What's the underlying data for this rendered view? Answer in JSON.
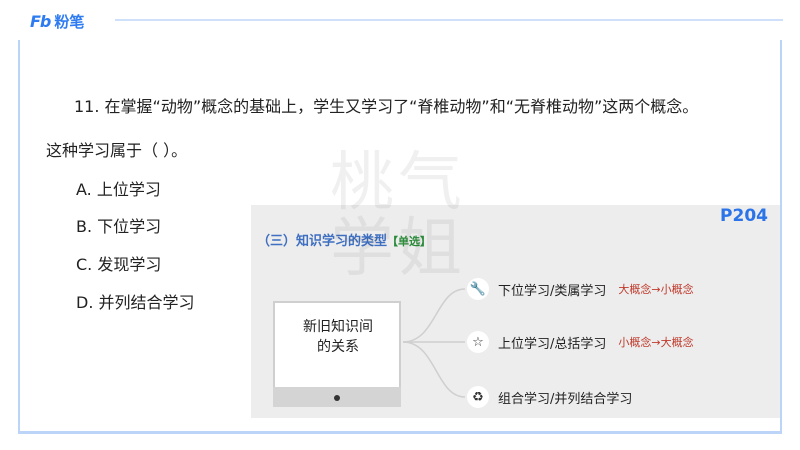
{
  "logo": {
    "mark": "Fb",
    "text": "粉笔"
  },
  "question": {
    "line1": "11. 在掌握“动物”概念的基础上，学生又学习了“脊椎动物”和“无脊椎动物”这两个概念。",
    "line2": "这种学习属于（  ）。",
    "options": [
      "A. 上位学习",
      "B. 下位学习",
      "C. 发现学习",
      "D. 并列结合学习"
    ]
  },
  "watermark": "桃气学姐",
  "panel": {
    "page_ref": "P204",
    "title": "（三）知识学习的类型",
    "tag": "【单选】",
    "center": "新旧知识间的关系",
    "nodes": [
      {
        "icon": "wrench-icon",
        "glyph": "🔧",
        "label": "下位学习/类属学习",
        "note": "大概念→小概念"
      },
      {
        "icon": "star-icon",
        "glyph": "☆",
        "label": "上位学习/总括学习",
        "note": "小概念→大概念"
      },
      {
        "icon": "recycle-icon",
        "glyph": "♻",
        "label": "组合学习/并列结合学习",
        "note": ""
      }
    ]
  },
  "colors": {
    "accent": "#2f7cf2",
    "title": "#3f6fc1",
    "note": "#c0392b",
    "tag": "#2b8b3a"
  }
}
